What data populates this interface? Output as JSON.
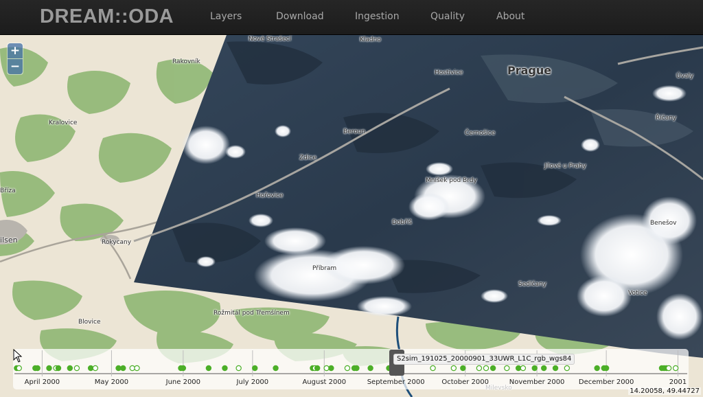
{
  "app": {
    "brand": "DREAM::ODA",
    "nav": [
      "Layers",
      "Download",
      "Ingestion",
      "Quality",
      "About"
    ]
  },
  "zoom": {
    "in_label": "+",
    "out_label": "−"
  },
  "map": {
    "places": [
      "Nové Strašecí",
      "Kladno",
      "Rakovník",
      "Hostivice",
      "Prague",
      "Úvaly",
      "Kralovice",
      "Beroun",
      "Černošice",
      "Říčany",
      "Zdice",
      "Jílové u Prahy",
      "Bříza",
      "Mníšek pod Brdy",
      "Hořovice",
      "Dobříš",
      "Benešov",
      "ilsen",
      "Rokycany",
      "Příbram",
      "Sedlčany",
      "Votice",
      "Rožmitál pod Třemšínem",
      "Blovice",
      "Milevsko"
    ],
    "coordinates": "14.20058, 49.44727",
    "colors": {
      "land": "#ece5d5",
      "forest": "#8fb774",
      "satellite": "#2b3a4c",
      "cloud": "#ffffff"
    }
  },
  "timeline": {
    "months": [
      "April 2000",
      "May 2000",
      "June 2000",
      "July 2000",
      "August 2000",
      "September 2000",
      "October 2000",
      "November 2000",
      "December 2000",
      "2001"
    ],
    "tooltip": "S2sim_191025_20000901_33UWR_L1C_rgb_wgs84",
    "marker_color": "#4caf28",
    "items": [
      {
        "date": "2000-03-21",
        "filled": true
      },
      {
        "date": "2000-03-22",
        "filled": false
      },
      {
        "date": "2000-03-29",
        "filled": true
      },
      {
        "date": "2000-03-30",
        "filled": true
      },
      {
        "date": "2000-04-04",
        "filled": true
      },
      {
        "date": "2000-04-07",
        "filled": false
      },
      {
        "date": "2000-04-08",
        "filled": true
      },
      {
        "date": "2000-04-13",
        "filled": true
      },
      {
        "date": "2000-04-16",
        "filled": false
      },
      {
        "date": "2000-04-22",
        "filled": true
      },
      {
        "date": "2000-04-24",
        "filled": false
      },
      {
        "date": "2000-05-04",
        "filled": true
      },
      {
        "date": "2000-05-06",
        "filled": true
      },
      {
        "date": "2000-05-10",
        "filled": false
      },
      {
        "date": "2000-05-12",
        "filled": false
      },
      {
        "date": "2000-05-31",
        "filled": true
      },
      {
        "date": "2000-06-01",
        "filled": true
      },
      {
        "date": "2000-06-12",
        "filled": true
      },
      {
        "date": "2000-06-19",
        "filled": true
      },
      {
        "date": "2000-06-25",
        "filled": false
      },
      {
        "date": "2000-07-02",
        "filled": true
      },
      {
        "date": "2000-07-11",
        "filled": true
      },
      {
        "date": "2000-07-27",
        "filled": true
      },
      {
        "date": "2000-07-28",
        "filled": false
      },
      {
        "date": "2000-07-29",
        "filled": true
      },
      {
        "date": "2000-08-02",
        "filled": false
      },
      {
        "date": "2000-08-04",
        "filled": true
      },
      {
        "date": "2000-08-11",
        "filled": false
      },
      {
        "date": "2000-08-14",
        "filled": true
      },
      {
        "date": "2000-08-15",
        "filled": true
      },
      {
        "date": "2000-08-21",
        "filled": true
      },
      {
        "date": "2000-08-29",
        "filled": true
      },
      {
        "date": "2000-09-17",
        "filled": false
      },
      {
        "date": "2000-09-26",
        "filled": false
      },
      {
        "date": "2000-09-30",
        "filled": true
      },
      {
        "date": "2000-10-07",
        "filled": false
      },
      {
        "date": "2000-10-10",
        "filled": false
      },
      {
        "date": "2000-10-13",
        "filled": true
      },
      {
        "date": "2000-10-19",
        "filled": false
      },
      {
        "date": "2000-10-24",
        "filled": true
      },
      {
        "date": "2000-10-26",
        "filled": false
      },
      {
        "date": "2000-10-31",
        "filled": true
      },
      {
        "date": "2000-11-04",
        "filled": true
      },
      {
        "date": "2000-11-09",
        "filled": true
      },
      {
        "date": "2000-11-14",
        "filled": false
      },
      {
        "date": "2000-11-27",
        "filled": true
      },
      {
        "date": "2000-11-30",
        "filled": true
      },
      {
        "date": "2000-12-01",
        "filled": true
      },
      {
        "date": "2000-12-25",
        "filled": true
      },
      {
        "date": "2000-12-26",
        "filled": true
      },
      {
        "date": "2000-12-27",
        "filled": true
      },
      {
        "date": "2000-12-28",
        "filled": false
      },
      {
        "date": "2000-12-31",
        "filled": false
      }
    ]
  }
}
